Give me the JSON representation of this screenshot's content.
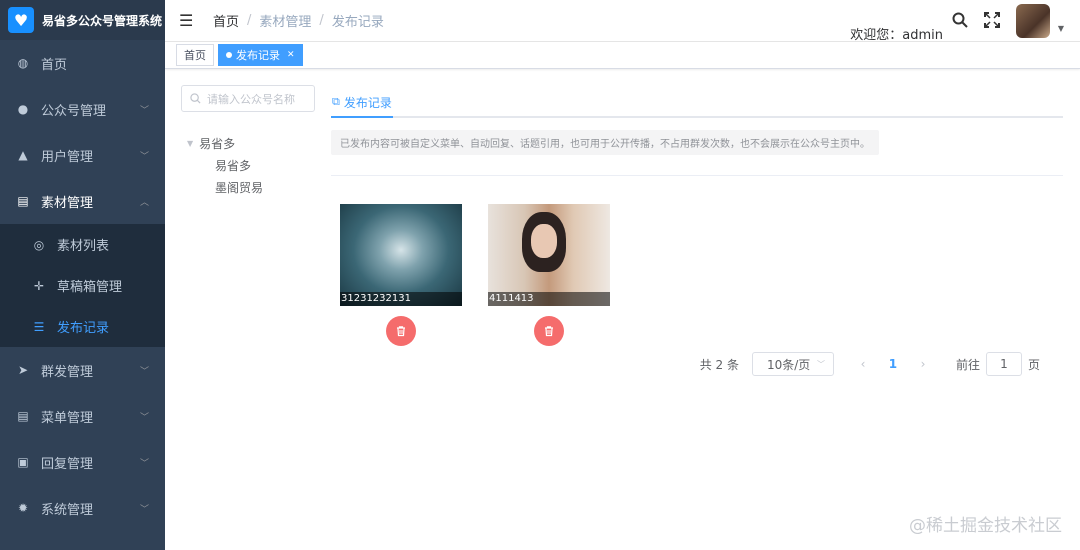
{
  "app": {
    "title": "易省多公众号管理系统"
  },
  "sidebar": {
    "items": [
      {
        "label": "首页",
        "icon": "dashboard-icon"
      },
      {
        "label": "公众号管理",
        "icon": "wechat-icon"
      },
      {
        "label": "用户管理",
        "icon": "user-icon"
      },
      {
        "label": "素材管理",
        "icon": "document-icon",
        "expanded": true
      },
      {
        "label": "群发管理",
        "icon": "send-icon"
      },
      {
        "label": "菜单管理",
        "icon": "menu-icon"
      },
      {
        "label": "回复管理",
        "icon": "reply-icon"
      },
      {
        "label": "系统管理",
        "icon": "gear-icon"
      }
    ],
    "subitems": [
      {
        "label": "素材列表",
        "icon": "aperture-icon"
      },
      {
        "label": "草稿箱管理",
        "icon": "move-icon"
      },
      {
        "label": "发布记录",
        "icon": "list-icon",
        "active": true
      }
    ]
  },
  "header": {
    "breadcrumb": [
      "首页",
      "素材管理",
      "发布记录"
    ],
    "welcome": "欢迎您：admin"
  },
  "tags": [
    {
      "label": "首页",
      "active": false
    },
    {
      "label": "发布记录",
      "active": true
    }
  ],
  "tree": {
    "search_placeholder": "请输入公众号名称",
    "root": "易省多",
    "children": [
      "易省多",
      "墨阁贸易"
    ]
  },
  "main": {
    "tab_label": "发布记录",
    "notice": "已发布内容可被自定义菜单、自动回复、话题引用，也可用于公开传播，不占用群发次数，也不会展示在公众号主页中。",
    "cards": [
      {
        "caption": "31231232131"
      },
      {
        "caption": "4111413"
      }
    ]
  },
  "pagination": {
    "total": "共 2 条",
    "page_size": "10条/页",
    "current": "1",
    "goto_label": "前往",
    "goto_value": "1",
    "page_unit": "页"
  },
  "watermark": "@稀土掘金技术社区",
  "colors": {
    "sidebar_bg": "#304156",
    "accent": "#409eff",
    "danger": "#f56c6c"
  }
}
